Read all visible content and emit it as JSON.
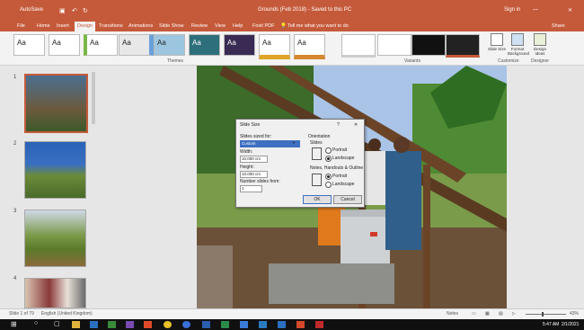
{
  "titlebar": {
    "left": "AutoSave",
    "doc": "Grounds (Feb 2018) - Saved to this PC",
    "signin": "Sign in",
    "share": "Share"
  },
  "tabs": [
    "File",
    "Home",
    "Insert",
    "Design",
    "Transitions",
    "Animations",
    "Slide Show",
    "Review",
    "View",
    "Help",
    "Foxit PDF"
  ],
  "active_tab": "Design",
  "tellme": "Tell me what you want to do",
  "ribbon": {
    "theme_label": "Aa",
    "themes_group": "Themes",
    "variants_group": "Variants",
    "customize_group": "Customize",
    "designer_group": "Designer",
    "slide_size": "Slide Size",
    "format_background": "Format Background",
    "design_ideas": "Design Ideas"
  },
  "thumbs": [
    "1",
    "2",
    "3",
    "4"
  ],
  "dialog": {
    "title": "Slide Size",
    "help": "?",
    "close": "✕",
    "sized_for_label": "Slides sized for:",
    "sized_for_value": "Custom",
    "width_label": "Width:",
    "width_value": "10.000 cm",
    "height_label": "Height:",
    "height_value": "10.000 cm",
    "number_from_label": "Number slides from:",
    "number_from_value": "1",
    "orientation_label": "Orientation",
    "slides_label": "Slides",
    "portrait": "Portrait",
    "landscape": "Landscape",
    "notes_label": "Notes, Handouts & Outline",
    "ok": "OK",
    "cancel": "Cancel"
  },
  "status": {
    "slide": "Slide 1 of 79",
    "language": "English (United Kingdom)",
    "notes": "Notes",
    "zoom": "43%"
  },
  "taskbar": {
    "time": "5:47 AM",
    "date": "2/1/2021"
  },
  "colors": {
    "accent": "#c55a3a",
    "ribbon": "#f3f3f3",
    "taskbar": "#101010"
  }
}
